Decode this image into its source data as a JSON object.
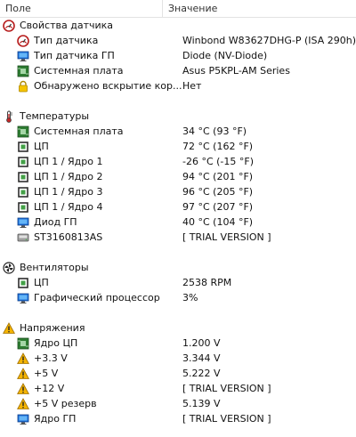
{
  "header": {
    "col_name": "Поле",
    "col_value": "Значение"
  },
  "sensor": {
    "title": "Свойства датчика",
    "items": [
      {
        "label": "Тип датчика",
        "value": "Winbond W83627DHG-P  (ISA 290h)"
      },
      {
        "label": "Тип датчика ГП",
        "value": "Diode  (NV-Diode)"
      },
      {
        "label": "Системная плата",
        "value": "Asus P5KPL-AM Series"
      },
      {
        "label": "Обнаружено вскрытие кор...",
        "value": "Нет"
      }
    ]
  },
  "temps": {
    "title": "Температуры",
    "items": [
      {
        "label": "Системная плата",
        "value": "34 °C  (93 °F)"
      },
      {
        "label": "ЦП",
        "value": "72 °C  (162 °F)"
      },
      {
        "label": "ЦП 1 / Ядро 1",
        "value": "-26 °C  (-15 °F)"
      },
      {
        "label": "ЦП 1 / Ядро 2",
        "value": "94 °C  (201 °F)"
      },
      {
        "label": "ЦП 1 / Ядро 3",
        "value": "96 °C  (205 °F)"
      },
      {
        "label": "ЦП 1 / Ядро 4",
        "value": "97 °C  (207 °F)"
      },
      {
        "label": "Диод ГП",
        "value": "40 °C  (104 °F)"
      },
      {
        "label": "ST3160813AS",
        "value": "[ TRIAL VERSION ]"
      }
    ]
  },
  "fans": {
    "title": "Вентиляторы",
    "items": [
      {
        "label": "ЦП",
        "value": "2538 RPM"
      },
      {
        "label": "Графический процессор",
        "value": "3%"
      }
    ]
  },
  "volts": {
    "title": "Напряжения",
    "items": [
      {
        "label": "Ядро ЦП",
        "value": "1.200 V"
      },
      {
        "label": "+3.3 V",
        "value": "3.344 V"
      },
      {
        "label": "+5 V",
        "value": "5.222 V"
      },
      {
        "label": "+12 V",
        "value": "[ TRIAL VERSION ]"
      },
      {
        "label": "+5 V резерв",
        "value": "5.139 V"
      },
      {
        "label": "Ядро ГП",
        "value": "[ TRIAL VERSION ]"
      }
    ]
  },
  "colors": {
    "chip_green": "#2e7d32",
    "monitor_blue": "#1e6fd9",
    "warning_yellow": "#f5b400",
    "thermo_red": "#c62828"
  }
}
